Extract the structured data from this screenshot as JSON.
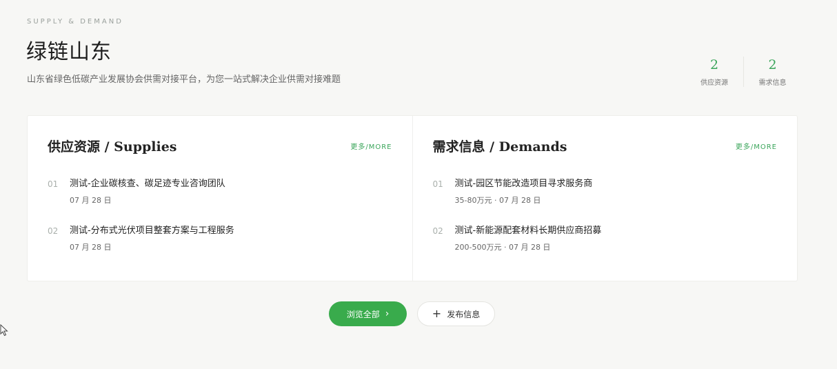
{
  "header": {
    "eyebrow": "SUPPLY & DEMAND",
    "title": "绿链山东",
    "subtitle": "山东省绿色低碳产业发展协会供需对接平台，为您一站式解决企业供需对接难题"
  },
  "stats": [
    {
      "value": "2",
      "label": "供应资源"
    },
    {
      "value": "2",
      "label": "需求信息"
    }
  ],
  "supplies": {
    "title": "供应资源 / Supplies",
    "more": "更多/MORE",
    "items": [
      {
        "index": "01",
        "title": "测试-企业碳核查、碳足迹专业咨询团队",
        "meta": "07 月 28 日"
      },
      {
        "index": "02",
        "title": "测试-分布式光伏项目整套方案与工程服务",
        "meta": "07 月 28 日"
      }
    ]
  },
  "demands": {
    "title": "需求信息 / Demands",
    "more": "更多/MORE",
    "items": [
      {
        "index": "01",
        "title": "测试-园区节能改造项目寻求服务商",
        "meta": "35-80万元 · 07 月 28 日"
      },
      {
        "index": "02",
        "title": "测试-新能源配套材料长期供应商招募",
        "meta": "200-500万元 · 07 月 28 日"
      }
    ]
  },
  "actions": {
    "browse_all": "浏览全部",
    "publish": "发布信息"
  },
  "colors": {
    "accent": "#39ab4c",
    "background": "#f7f7f5"
  },
  "icons": {
    "browse_all": "chevron-right-icon",
    "publish": "plus-icon"
  }
}
